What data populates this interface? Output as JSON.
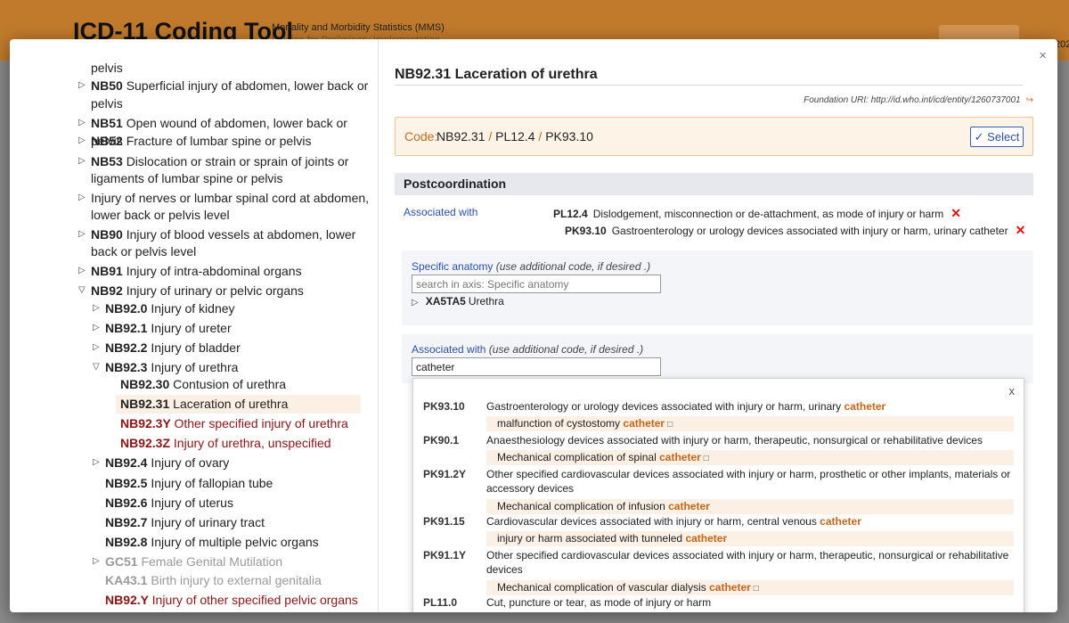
{
  "app": {
    "title": "ICD-11 Coding Tool",
    "subtitle": "Mortality and Morbidity Statistics (MMS)",
    "subtitle2": "Version for Preliminary Implementation",
    "top_right_fragment": "202"
  },
  "modal": {
    "close": "×"
  },
  "tree": {
    "rows": [
      {
        "code": "",
        "label": "pelvis",
        "tri": "",
        "cls": ""
      },
      {
        "code": "NB50",
        "label": "Superficial injury of abdomen, lower back or",
        "tri": "▷",
        "cls": ""
      },
      {
        "code": "",
        "label": "pelvis",
        "tri": "",
        "cls": ""
      },
      {
        "code": "NB51",
        "label": "Open wound of abdomen, lower back or pelvis",
        "tri": "▷",
        "cls": ""
      },
      {
        "code": "NB52",
        "label": "Fracture of lumbar spine or pelvis",
        "tri": "▷",
        "cls": ""
      },
      {
        "code": "NB53",
        "label": "Dislocation or strain or sprain of joints or",
        "tri": "▷",
        "cls": ""
      },
      {
        "code": "",
        "label": "ligaments of lumbar spine or pelvis",
        "tri": "",
        "cls": ""
      },
      {
        "code": "",
        "label": "Injury of nerves or lumbar spinal cord at abdomen,",
        "tri": "▷",
        "cls": ""
      },
      {
        "code": "",
        "label": "lower back or pelvis level",
        "tri": "",
        "cls": ""
      },
      {
        "code": "NB90",
        "label": "Injury of blood vessels at abdomen, lower",
        "tri": "▷",
        "cls": ""
      },
      {
        "code": "",
        "label": "back or pelvis level",
        "tri": "",
        "cls": ""
      },
      {
        "code": "NB91",
        "label": "Injury of intra-abdominal organs",
        "tri": "▷",
        "cls": ""
      },
      {
        "code": "NB92",
        "label": "Injury of urinary or pelvic organs",
        "tri": "▽",
        "cls": ""
      },
      {
        "code": "NB92.0",
        "label": "Injury of kidney",
        "tri": "▷",
        "cls": ""
      },
      {
        "code": "NB92.1",
        "label": "Injury of ureter",
        "tri": "▷",
        "cls": ""
      },
      {
        "code": "NB92.2",
        "label": "Injury of bladder",
        "tri": "▷",
        "cls": ""
      },
      {
        "code": "NB92.3",
        "label": "Injury of urethra",
        "tri": "▽",
        "cls": ""
      },
      {
        "code": "NB92.30",
        "label": "Contusion of urethra",
        "tri": "",
        "cls": ""
      },
      {
        "code": "NB92.31",
        "label": "Laceration of urethra",
        "tri": "",
        "cls": "selected"
      },
      {
        "code": "NB92.3Y",
        "label": "Other specified injury of urethra",
        "tri": "",
        "cls": "red"
      },
      {
        "code": "NB92.3Z",
        "label": "Injury of urethra, unspecified",
        "tri": "",
        "cls": "red"
      },
      {
        "code": "NB92.4",
        "label": "Injury of ovary",
        "tri": "▷",
        "cls": ""
      },
      {
        "code": "NB92.5",
        "label": "Injury of fallopian tube",
        "tri": "",
        "cls": ""
      },
      {
        "code": "NB92.6",
        "label": "Injury of uterus",
        "tri": "",
        "cls": ""
      },
      {
        "code": "NB92.7",
        "label": "Injury of urinary tract",
        "tri": "",
        "cls": ""
      },
      {
        "code": "NB92.8",
        "label": "Injury of multiple pelvic organs",
        "tri": "",
        "cls": ""
      },
      {
        "code": "GC51",
        "label": "Female Genital Mutilation",
        "tri": "▷",
        "cls": "grey"
      },
      {
        "code": "KA43.1",
        "label": "Birth injury to external genitalia",
        "tri": "",
        "cls": "grey"
      },
      {
        "code": "NB92.Y",
        "label": "Injury of other specified pelvic organs",
        "tri": "",
        "cls": "red"
      }
    ]
  },
  "detail": {
    "title": "NB92.31 Laceration of urethra",
    "foundation_uri": "Foundation URI: http://id.who.int/icd/entity/1260737001",
    "external_link_icon": "↪",
    "code_label": "Code:",
    "codes": [
      "NB92.31",
      "PL12.4",
      "PK93.10"
    ],
    "code_separator": "/",
    "select_button": "✓ Select",
    "postcoordination_header": "Postcoordination",
    "associated_with_label": "Associated with",
    "assoc_items": [
      {
        "code": "PL12.4",
        "desc": "Dislodgement, misconnection or de-attachment, as mode of injury or harm"
      },
      {
        "code": "PK93.10",
        "desc": "Gastroenterology or urology devices associated with injury or harm, urinary catheter"
      }
    ],
    "remove_icon": "✕",
    "specific_anatomy": {
      "label": "Specific anatomy",
      "hint": "(use additional code, if desired .)",
      "placeholder": "search in axis: Specific anatomy",
      "result_code": "XA5TA5",
      "result_label": "Urethra"
    },
    "associated_axis": {
      "label": "Associated with",
      "hint": "(use additional code, if desired .)",
      "value": "catheter"
    }
  },
  "dropdown": {
    "close": "x",
    "items": [
      {
        "code": "PK93.10",
        "desc_pre": "Gastroenterology or urology devices associated with injury or harm, urinary ",
        "desc_hl": "catheter",
        "sub_pre": "malfunction of cystostomy ",
        "sub_hl": "catheter",
        "sub_sq": "□"
      },
      {
        "code": "PK90.1",
        "desc_pre": "Anaesthesiology devices associated with injury or harm, therapeutic, nonsurgical or rehabilitative devices",
        "desc_hl": "",
        "sub_pre": "Mechanical complication of spinal ",
        "sub_hl": "catheter",
        "sub_sq": "□"
      },
      {
        "code": "PK91.2Y",
        "desc_pre": "Other specified cardiovascular devices associated with injury or harm, prosthetic or other implants, materials or accessory devices",
        "desc_hl": "",
        "sub_pre": "Mechanical complication of infusion ",
        "sub_hl": "catheter",
        "sub_sq": ""
      },
      {
        "code": "PK91.15",
        "desc_pre": "Cardiovascular devices associated with injury or harm, central venous ",
        "desc_hl": "catheter",
        "sub_pre": "injury or harm associated with tunneled ",
        "sub_hl": "catheter",
        "sub_sq": ""
      },
      {
        "code": "PK91.1Y",
        "desc_pre": "Other specified cardiovascular devices associated with injury or harm, therapeutic, nonsurgical or rehabilitative devices",
        "desc_hl": "",
        "sub_pre": "Mechanical complication of vascular dialysis ",
        "sub_hl": "catheter",
        "sub_sq": "□"
      },
      {
        "code": "PL11.0",
        "desc_pre": "Cut, puncture or tear, as mode of injury or harm",
        "desc_hl": "",
        "sub_pre": "",
        "sub_hl": "",
        "sub_sq": ""
      }
    ]
  }
}
